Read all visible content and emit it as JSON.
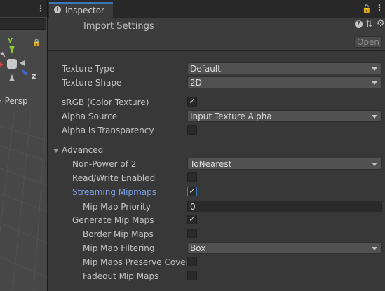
{
  "scene": {
    "gizmo_y": "y",
    "gizmo_z": "z",
    "projection_label": "‹ Persp",
    "colors": {
      "background": "#474747",
      "gizmo_y": "#8fcb35",
      "gizmo_x": "#d9453f",
      "gizmo_z": "#3e6ad9"
    }
  },
  "inspector": {
    "tab_label": "Inspector",
    "tab_icon": "info-icon",
    "title": "Import Settings",
    "open_button": "Open",
    "accent_color": "#3a79bb",
    "texture_type": {
      "label": "Texture Type",
      "value": "Default"
    },
    "texture_shape": {
      "label": "Texture Shape",
      "value": "2D"
    },
    "srgb": {
      "label": "sRGB (Color Texture)",
      "checked": true
    },
    "alpha_source": {
      "label": "Alpha Source",
      "value": "Input Texture Alpha"
    },
    "alpha_transparency": {
      "label": "Alpha Is Transparency",
      "checked": false
    },
    "advanced": {
      "label": "Advanced",
      "expanded": true,
      "non_power_of_2": {
        "label": "Non-Power of 2",
        "value": "ToNearest"
      },
      "read_write": {
        "label": "Read/Write Enabled",
        "checked": false
      },
      "streaming_mipmaps": {
        "label": "Streaming Mipmaps",
        "checked": true
      },
      "mip_map_priority": {
        "label": "Mip Map Priority",
        "value": "0"
      },
      "generate_mip_maps": {
        "label": "Generate Mip Maps",
        "checked": true
      },
      "border_mip_maps": {
        "label": "Border Mip Maps",
        "checked": false
      },
      "mip_map_filtering": {
        "label": "Mip Map Filtering",
        "value": "Box"
      },
      "preserve_coverage": {
        "label": "Mip Maps Preserve Coverage",
        "checked": false
      },
      "fadeout_mip_maps": {
        "label": "Fadeout Mip Maps",
        "checked": false
      }
    }
  }
}
